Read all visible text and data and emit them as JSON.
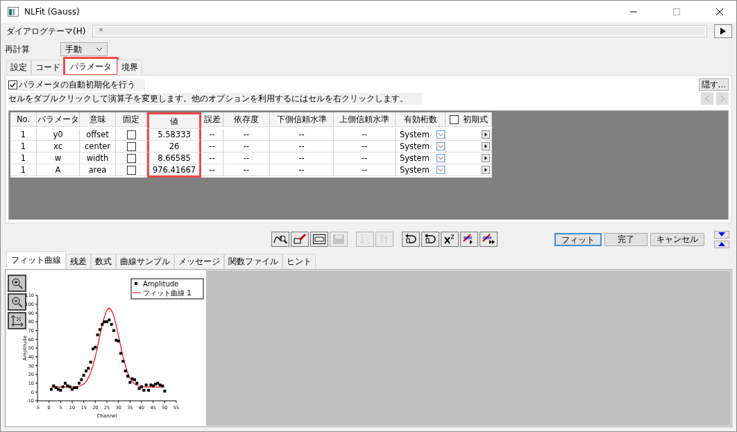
{
  "window": {
    "title": "NLFit (Gauss)"
  },
  "theme": {
    "label": "ダイアログテーマ(H)",
    "placeholder": "*"
  },
  "recalc": {
    "label": "再計算",
    "value": "手動"
  },
  "tabs": [
    {
      "label": "設定",
      "selected": false,
      "highlighted": false
    },
    {
      "label": "コード",
      "selected": false,
      "highlighted": false
    },
    {
      "label": "パラメータ",
      "selected": true,
      "highlighted": true
    },
    {
      "label": "境界",
      "selected": false,
      "highlighted": false
    }
  ],
  "auto_init": {
    "label": "パラメータの自動初期化を行う",
    "checked": true
  },
  "hint": "セルをダブルクリックして演算子を変更します。他のオプションを利用するにはセルを右クリックします。",
  "hide_button": "隠す...",
  "table": {
    "columns": [
      {
        "label": "No.",
        "highlighted": false
      },
      {
        "label": "パラメータ",
        "highlighted": false
      },
      {
        "label": "意味",
        "highlighted": false
      },
      {
        "label": "固定",
        "highlighted": false
      },
      {
        "label": "値",
        "highlighted": true
      },
      {
        "label": "誤差",
        "highlighted": false
      },
      {
        "label": "依存度",
        "highlighted": false
      },
      {
        "label": "下側信頼水準",
        "highlighted": false
      },
      {
        "label": "上側信頼水準",
        "highlighted": false
      },
      {
        "label": "有効桁数",
        "highlighted": false
      },
      {
        "label": "初期式",
        "highlighted": false,
        "checked": false
      }
    ],
    "rows": [
      {
        "no": "1",
        "param": "y0",
        "meaning": "offset",
        "fixed": false,
        "value": "5.58333",
        "error": "--",
        "dependency": "--",
        "lower": "--",
        "upper": "--",
        "digits": "System"
      },
      {
        "no": "1",
        "param": "xc",
        "meaning": "center",
        "fixed": false,
        "value": "26",
        "error": "--",
        "dependency": "--",
        "lower": "--",
        "upper": "--",
        "digits": "System"
      },
      {
        "no": "1",
        "param": "w",
        "meaning": "width",
        "fixed": false,
        "value": "8.66585",
        "error": "--",
        "dependency": "--",
        "lower": "--",
        "upper": "--",
        "digits": "System"
      },
      {
        "no": "1",
        "param": "A",
        "meaning": "area",
        "fixed": false,
        "value": "976.41667",
        "error": "--",
        "dependency": "--",
        "lower": "--",
        "upper": "--",
        "digits": "System"
      }
    ]
  },
  "toolbar": [
    {
      "kind": "icon",
      "disabled": false
    },
    {
      "kind": "icon",
      "disabled": false
    },
    {
      "kind": "icon",
      "disabled": false
    },
    {
      "kind": "icon",
      "disabled": true
    },
    {
      "kind": "icon",
      "disabled": true
    },
    {
      "kind": "icon",
      "disabled": true
    },
    {
      "kind": "icon",
      "disabled": false
    },
    {
      "kind": "icon",
      "disabled": false
    },
    {
      "kind": "icon",
      "disabled": false
    },
    {
      "kind": "icon",
      "disabled": false
    },
    {
      "kind": "icon",
      "disabled": false
    },
    {
      "kind": "text",
      "label": "フィット",
      "selected": true
    },
    {
      "kind": "text",
      "label": "完了",
      "selected": false
    },
    {
      "kind": "text",
      "label": "キャンセル",
      "selected": false
    }
  ],
  "bottom_tabs": [
    {
      "label": "フィット曲線",
      "selected": true
    },
    {
      "label": "残差",
      "selected": false
    },
    {
      "label": "数式",
      "selected": false
    },
    {
      "label": "曲線サンプル",
      "selected": false
    },
    {
      "label": "メッセージ",
      "selected": false
    },
    {
      "label": "関数ファイル",
      "selected": false
    },
    {
      "label": "ヒント",
      "selected": false
    }
  ],
  "chart_data": {
    "type": "scatter",
    "legend": "upper right",
    "xlabel": "Channel",
    "ylabel": "Amplitude",
    "xlim": [
      -5,
      55
    ],
    "ylim": [
      -10,
      110
    ],
    "xticks": [
      -5,
      0,
      5,
      10,
      15,
      20,
      25,
      30,
      35,
      40,
      45,
      50,
      55
    ],
    "yticks": [
      -10,
      0,
      10,
      20,
      30,
      40,
      50,
      60,
      70,
      80,
      90,
      100,
      110
    ],
    "x": [
      1,
      2,
      3,
      4,
      5,
      6,
      7,
      8,
      9,
      10,
      11,
      12,
      13,
      14,
      15,
      16,
      17,
      18,
      19,
      20,
      21,
      22,
      23,
      24,
      25,
      26,
      27,
      28,
      29,
      30,
      31,
      32,
      33,
      34,
      35,
      36,
      37,
      38,
      39,
      40,
      41,
      42,
      43,
      44,
      45,
      46,
      47,
      48,
      49,
      50
    ],
    "series": [
      {
        "name": "Amplitude",
        "color": "#000000",
        "values": [
          3,
          7,
          5,
          3,
          2,
          6,
          10,
          7,
          6,
          3,
          5,
          5,
          10,
          14,
          19,
          24,
          27,
          34,
          49,
          51,
          65,
          71,
          77,
          80,
          80,
          82,
          77,
          70,
          59,
          58,
          44,
          35,
          24,
          18,
          11,
          15,
          14,
          10,
          4,
          6,
          2,
          8,
          2,
          8,
          7,
          9,
          10,
          8,
          7,
          1
        ]
      },
      {
        "name": "フィット曲線 1",
        "color": "#ff0000",
        "type": "line",
        "values": [
          5.6,
          5.6,
          5.6,
          5.6,
          5.6,
          5.6,
          5.6,
          5.6,
          5.6,
          5.7,
          5.8,
          6.1,
          6.6,
          7.5,
          9.2,
          11.8,
          16.0,
          22.0,
          30.0,
          40.1,
          51.8,
          64.3,
          76.3,
          86.4,
          93.1,
          95.5,
          93.1,
          86.4,
          76.3,
          64.3,
          51.8,
          40.1,
          30.0,
          22.0,
          16.0,
          11.8,
          9.2,
          7.5,
          6.6,
          6.1,
          5.8,
          5.7,
          5.6,
          5.6,
          5.6,
          5.6,
          5.6,
          5.6,
          5.6,
          5.6
        ]
      }
    ]
  }
}
